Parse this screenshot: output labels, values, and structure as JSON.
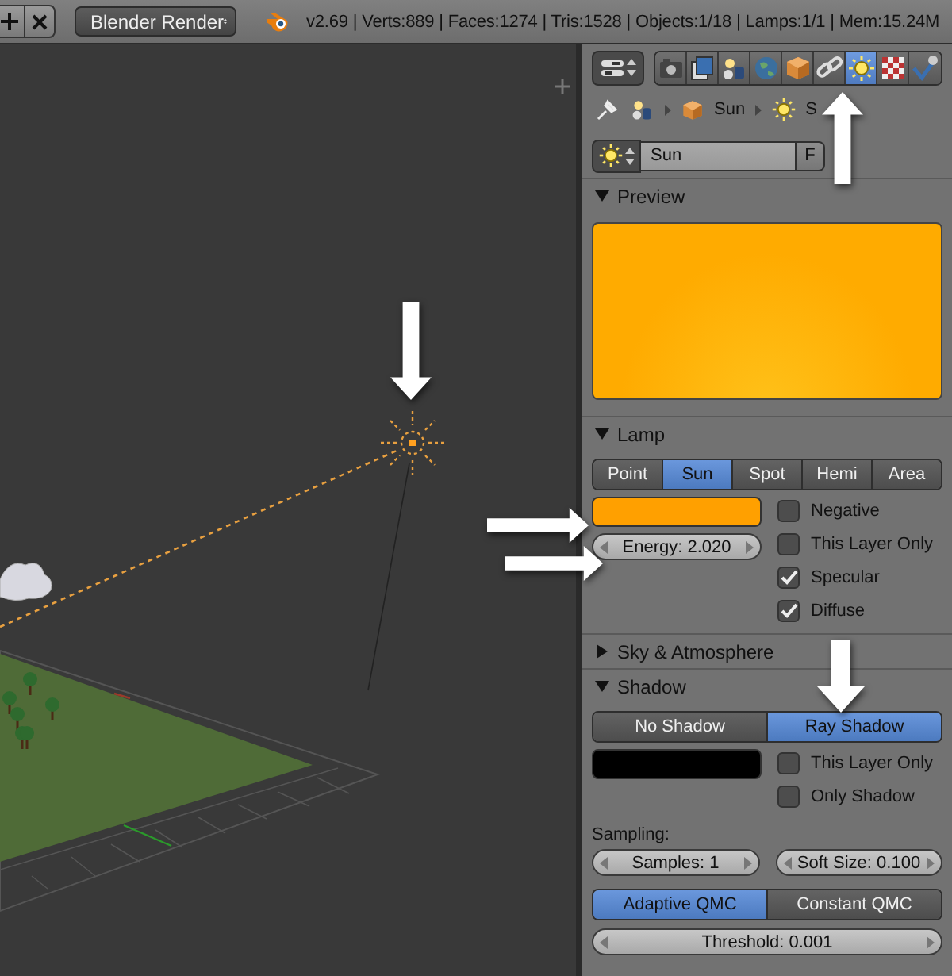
{
  "header": {
    "render_engine": "Blender Render",
    "stats": "v2.69 | Verts:889 | Faces:1274 | Tris:1528 | Objects:1/18 | Lamps:1/1 | Mem:15.24M"
  },
  "properties": {
    "context_tabs": [
      {
        "kind": "camera",
        "selected": false
      },
      {
        "kind": "layers",
        "selected": false
      },
      {
        "kind": "scene",
        "selected": false
      },
      {
        "kind": "world",
        "selected": false
      },
      {
        "kind": "object",
        "selected": false
      },
      {
        "kind": "constraints",
        "selected": false
      },
      {
        "kind": "lamp",
        "selected": true
      },
      {
        "kind": "texture",
        "selected": false
      },
      {
        "kind": "tick",
        "selected": false
      }
    ],
    "breadcrumb": [
      "Sun",
      "S"
    ],
    "datablock": {
      "name": "Sun",
      "fake_user": "F"
    },
    "preview": {
      "title": "Preview",
      "expanded": true
    },
    "lamp": {
      "title": "Lamp",
      "expanded": true,
      "types": [
        {
          "label": "Point",
          "selected": false
        },
        {
          "label": "Sun",
          "selected": true
        },
        {
          "label": "Spot",
          "selected": false
        },
        {
          "label": "Hemi",
          "selected": false
        },
        {
          "label": "Area",
          "selected": false
        }
      ],
      "color": "#ffa000",
      "energy": "Energy: 2.020",
      "options": [
        {
          "label": "Negative",
          "checked": false
        },
        {
          "label": "This Layer Only",
          "checked": false
        },
        {
          "label": "Specular",
          "checked": true
        },
        {
          "label": "Diffuse",
          "checked": true
        }
      ]
    },
    "sky": {
      "title": "Sky & Atmosphere",
      "expanded": false
    },
    "shadow": {
      "title": "Shadow",
      "expanded": true,
      "modes": [
        {
          "label": "No Shadow",
          "selected": false
        },
        {
          "label": "Ray Shadow",
          "selected": true
        }
      ],
      "color": "#000000",
      "options": [
        {
          "label": "This Layer Only",
          "checked": false
        },
        {
          "label": "Only Shadow",
          "checked": false
        }
      ],
      "sampling_label": "Sampling:",
      "samples": "Samples: 1",
      "soft_size": "Soft Size: 0.100",
      "methods": [
        {
          "label": "Adaptive QMC",
          "selected": true
        },
        {
          "label": "Constant QMC",
          "selected": false
        }
      ],
      "threshold": "Threshold: 0.001"
    }
  }
}
